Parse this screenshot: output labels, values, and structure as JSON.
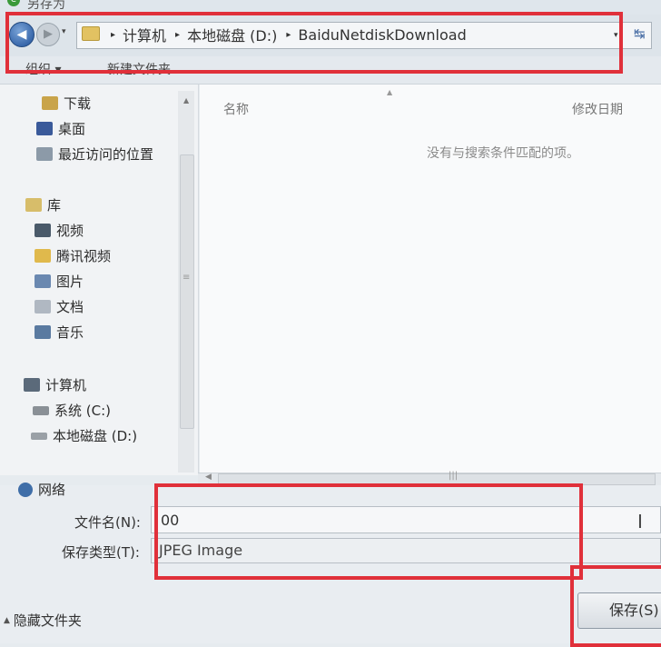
{
  "window": {
    "title": "另存为"
  },
  "address_bar": {
    "back_glyph": "◀",
    "forward_glyph": "▶",
    "dropdown_glyph": "▾",
    "separator_glyph": "▸",
    "refresh_glyph": "↹",
    "breadcrumbs": [
      "计算机",
      "本地磁盘 (D:)",
      "BaiduNetdiskDownload"
    ]
  },
  "toolbar": {
    "organize_label": "组织 ▾",
    "new_folder_label": "新建文件夹"
  },
  "nav": {
    "favorites": [
      {
        "label": "下载",
        "icon": "download-folder-icon",
        "color": "#c9a44a"
      },
      {
        "label": "桌面",
        "icon": "desktop-icon",
        "color": "#3a5a9a"
      },
      {
        "label": "最近访问的位置",
        "icon": "recent-places-icon",
        "color": "#8c9aa8"
      }
    ],
    "libraries_label": "库",
    "libraries": [
      {
        "label": "视频",
        "icon": "video-library-icon",
        "color": "#4a5a6a"
      },
      {
        "label": "腾讯视频",
        "icon": "folder-icon",
        "color": "#e0b94c"
      },
      {
        "label": "图片",
        "icon": "pictures-library-icon",
        "color": "#6a88b0"
      },
      {
        "label": "文档",
        "icon": "documents-library-icon",
        "color": "#b0b8c2"
      },
      {
        "label": "音乐",
        "icon": "music-library-icon",
        "color": "#5a7aa0"
      }
    ],
    "computer_label": "计算机",
    "drives": [
      {
        "label": "系统 (C:)",
        "icon": "drive-c-icon",
        "color": "#8a9096"
      },
      {
        "label": "本地磁盘 (D:)",
        "icon": "drive-d-icon",
        "color": "#9aa0a6"
      }
    ],
    "network_label": "网络"
  },
  "content": {
    "column_name": "名称",
    "column_date": "修改日期",
    "empty_message": "没有与搜索条件匹配的项。"
  },
  "form": {
    "filename_label": "文件名(N):",
    "filename_value": "00",
    "filetype_label": "保存类型(T):",
    "filetype_value": "JPEG Image"
  },
  "footer": {
    "hide_folders_label": "隐藏文件夹",
    "save_label": "保存(S)"
  },
  "colors": {
    "highlight_red": "#e0303a",
    "window_bg": "#e6ebef"
  }
}
